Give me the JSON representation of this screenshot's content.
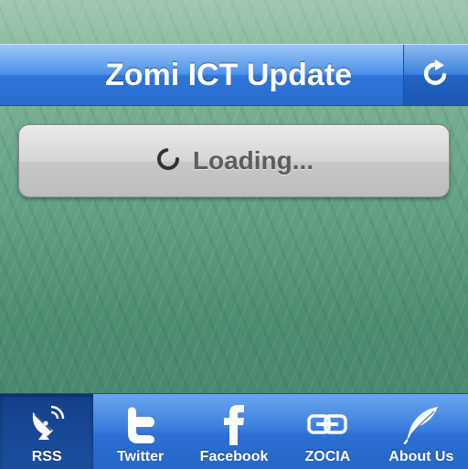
{
  "navbar": {
    "title": "Zomi ICT Update",
    "refresh_icon": "refresh-icon"
  },
  "loading": {
    "text": "Loading...",
    "icon": "spinner-icon"
  },
  "tabbar": {
    "active_index": 0,
    "tabs": [
      {
        "label": "RSS",
        "icon": "satellite-dish-icon"
      },
      {
        "label": "Twitter",
        "icon": "twitter-icon"
      },
      {
        "label": "Facebook",
        "icon": "facebook-icon"
      },
      {
        "label": "ZOCIA",
        "icon": "link-icon"
      },
      {
        "label": "About Us",
        "icon": "feather-icon"
      }
    ]
  },
  "colors": {
    "bar_blue": "#2f75d9",
    "active_tab": "#1b4f9f",
    "loading_text": "#5d5d5d"
  }
}
